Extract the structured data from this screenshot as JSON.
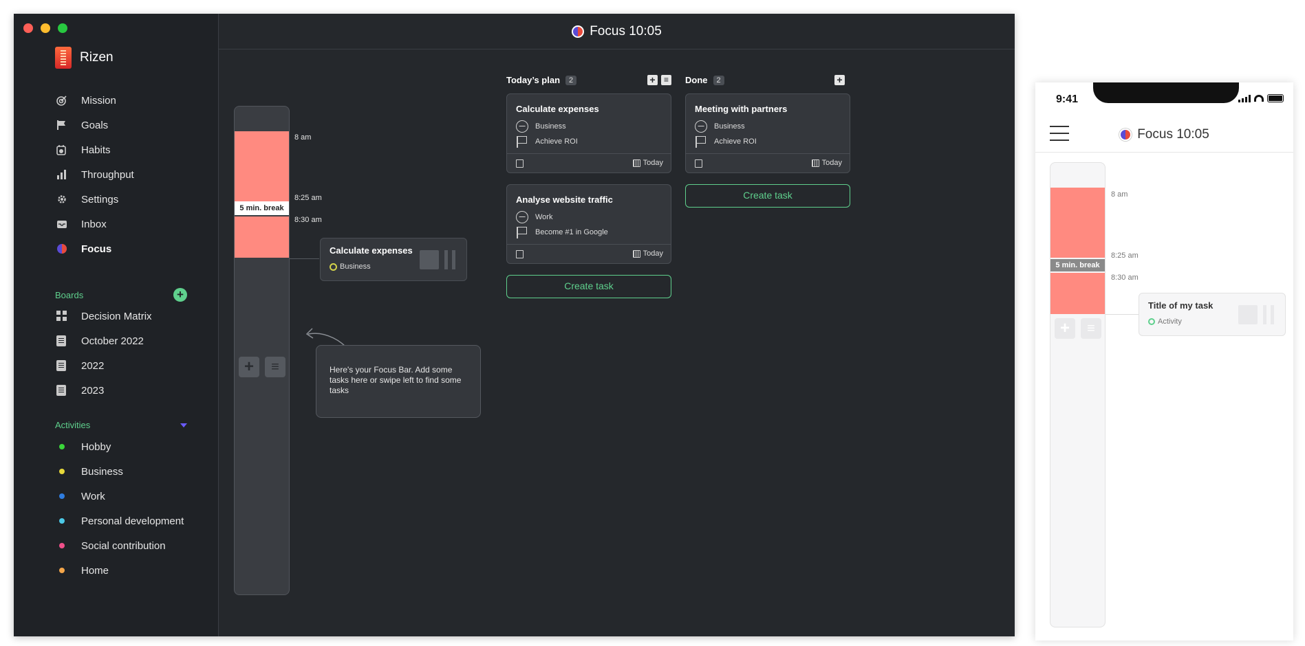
{
  "app": {
    "name": "Rizen",
    "title": "Focus 10:05"
  },
  "sidebar": {
    "nav": [
      {
        "label": "Mission",
        "icon": "target-icon"
      },
      {
        "label": "Goals",
        "icon": "flag-icon"
      },
      {
        "label": "Habits",
        "icon": "habits-icon"
      },
      {
        "label": "Throughput",
        "icon": "bar-chart-icon"
      },
      {
        "label": "Settings",
        "icon": "gear-icon"
      },
      {
        "label": "Inbox",
        "icon": "inbox-icon"
      },
      {
        "label": "Focus",
        "icon": "focus-icon"
      }
    ],
    "boards_heading": "Boards",
    "boards": [
      "Decision Matrix",
      "October 2022",
      "2022",
      "2023"
    ],
    "activities_heading": "Activities",
    "activities": [
      {
        "label": "Hobby",
        "color": "#3ad63a"
      },
      {
        "label": "Business",
        "color": "#e6d83a"
      },
      {
        "label": "Work",
        "color": "#2f7de0"
      },
      {
        "label": "Personal development",
        "color": "#4cc9e6"
      },
      {
        "label": "Social contribution",
        "color": "#f0508a"
      },
      {
        "label": "Home",
        "color": "#f4a64a"
      }
    ]
  },
  "focus_bar": {
    "times": [
      "8 am",
      "8:25 am",
      "8:30 am"
    ],
    "break_label": "5 min. break",
    "current_task": {
      "title": "Calculate expenses",
      "activity": "Business"
    },
    "tip": "Here's your Focus Bar. Add some tasks here or swipe left to find some tasks"
  },
  "columns": [
    {
      "title": "Today’s plan",
      "count": "2",
      "tasks": [
        {
          "title": "Calculate expenses",
          "activity": "Business",
          "goal": "Achieve ROI",
          "due": "Today"
        },
        {
          "title": "Analyse website traffic",
          "activity": "Work",
          "goal": "Become #1 in Google",
          "due": "Today"
        }
      ],
      "create_label": "Create task"
    },
    {
      "title": "Done",
      "count": "2",
      "tasks": [
        {
          "title": "Meeting with partners",
          "activity": "Business",
          "goal": "Achieve ROI",
          "due": "Today"
        }
      ],
      "create_label": "Create task"
    }
  ],
  "phone": {
    "time": "9:41",
    "title": "Focus 10:05",
    "times": [
      "8 am",
      "8:25 am",
      "8:30 am"
    ],
    "break_label": "5 min. break",
    "task": {
      "title": "Title of my task",
      "activity": "Activity"
    }
  }
}
